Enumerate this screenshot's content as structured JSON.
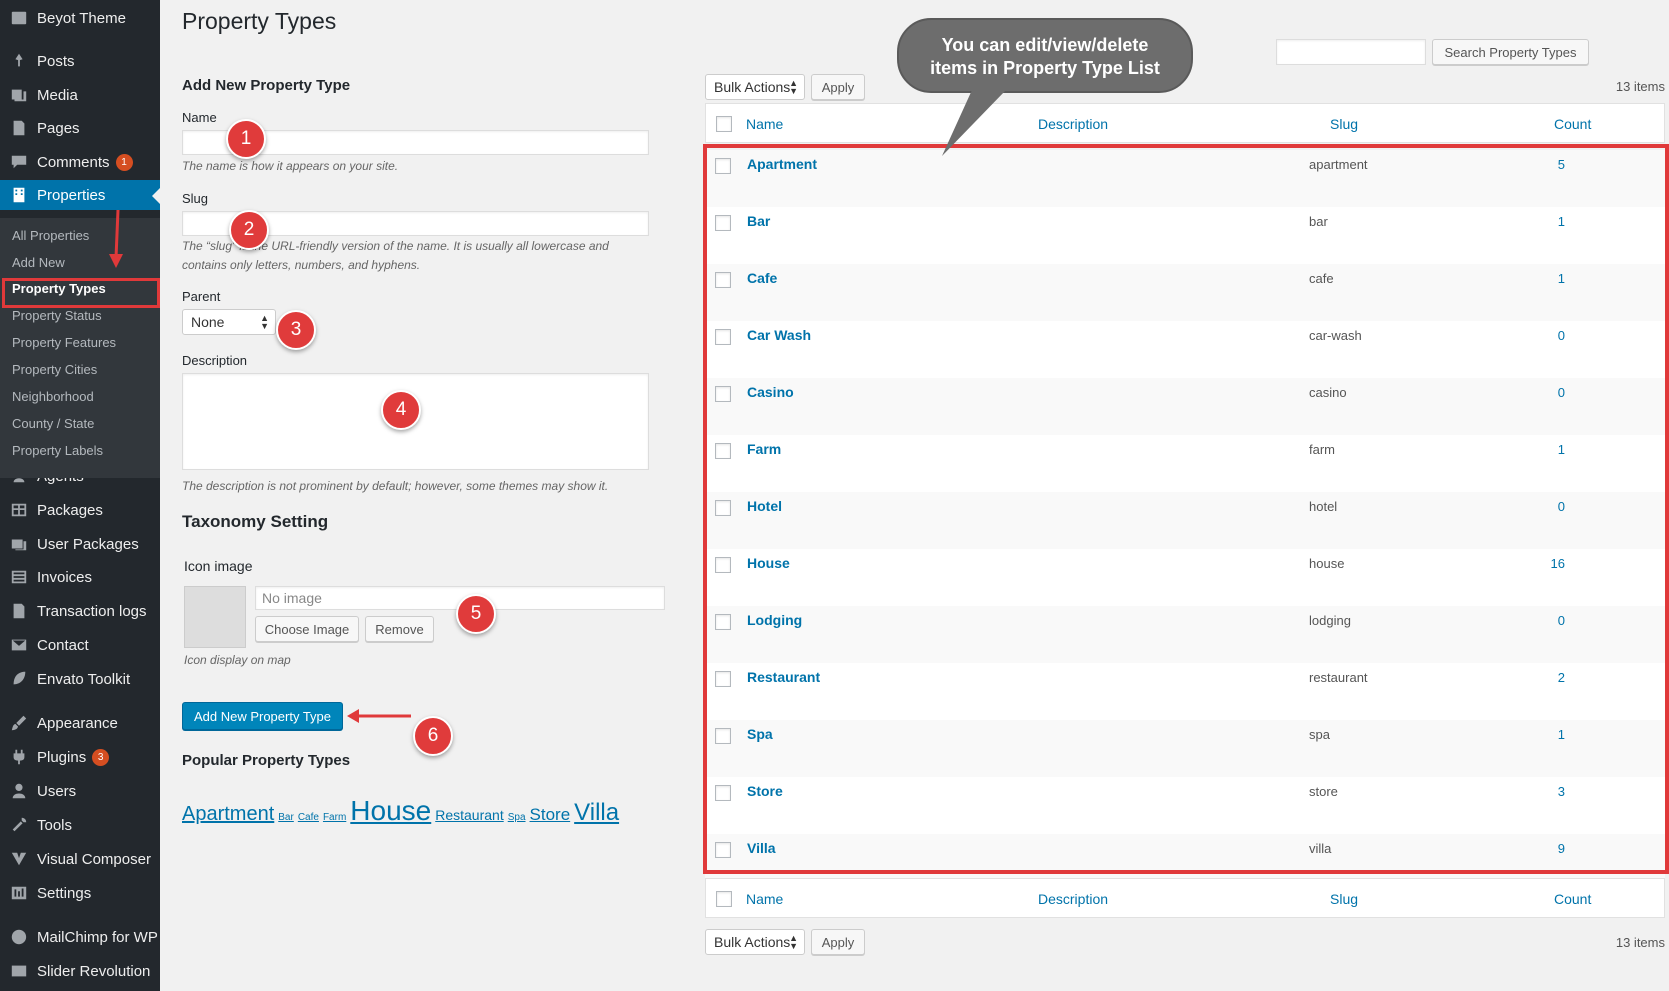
{
  "sidebar": {
    "site_title": "Beyot Theme",
    "items": [
      {
        "label": "Posts",
        "icon": "pin-icon"
      },
      {
        "label": "Media",
        "icon": "media-icon"
      },
      {
        "label": "Pages",
        "icon": "pages-icon"
      },
      {
        "label": "Comments",
        "icon": "comments-icon",
        "badge": "1"
      },
      {
        "label": "Properties",
        "icon": "building-icon",
        "active": true
      },
      {
        "label": "Agents",
        "icon": "agent-icon"
      },
      {
        "label": "Packages",
        "icon": "grid-icon"
      },
      {
        "label": "User Packages",
        "icon": "user-packages-icon"
      },
      {
        "label": "Invoices",
        "icon": "list-icon"
      },
      {
        "label": "Transaction logs",
        "icon": "log-icon"
      },
      {
        "label": "Contact",
        "icon": "mail-icon"
      },
      {
        "label": "Envato Toolkit",
        "icon": "leaf-icon"
      },
      {
        "label": "Appearance",
        "icon": "brush-icon"
      },
      {
        "label": "Plugins",
        "icon": "plugin-icon",
        "badge": "3"
      },
      {
        "label": "Users",
        "icon": "user-icon"
      },
      {
        "label": "Tools",
        "icon": "wrench-icon"
      },
      {
        "label": "Visual Composer",
        "icon": "vc-icon"
      },
      {
        "label": "Settings",
        "icon": "settings-icon"
      },
      {
        "label": "MailChimp for WP",
        "icon": "mailchimp-icon"
      },
      {
        "label": "Slider Revolution",
        "icon": "slider-icon"
      }
    ],
    "submenu": [
      "All Properties",
      "Add New",
      "Property Types",
      "Property Status",
      "Property Features",
      "Property Cities",
      "Neighborhood",
      "County / State",
      "Property Labels"
    ]
  },
  "page": {
    "title": "Property Types",
    "form_title": "Add New Property Type",
    "name_label": "Name",
    "name_hint": "The name is how it appears on your site.",
    "slug_label": "Slug",
    "slug_hint_1": "The “slug” is the URL-friendly version of the name. It is usually all lowercase and",
    "slug_hint_2": "contains only letters, numbers, and hyphens.",
    "parent_label": "Parent",
    "parent_value": "None",
    "description_label": "Description",
    "description_hint": "The description is not prominent by default; however, some themes may show it.",
    "taxonomy_title": "Taxonomy Setting",
    "icon_label": "Icon image",
    "icon_placeholder": "No image",
    "choose_image": "Choose Image",
    "remove": "Remove",
    "icon_hint": "Icon display on map",
    "submit": "Add New Property Type",
    "popular_title": "Popular Property Types",
    "tags": [
      {
        "label": "Apartment",
        "size": 20
      },
      {
        "label": "Bar",
        "size": 10
      },
      {
        "label": "Cafe",
        "size": 10
      },
      {
        "label": "Farm",
        "size": 10
      },
      {
        "label": "House",
        "size": 28
      },
      {
        "label": "Restaurant",
        "size": 14
      },
      {
        "label": "Spa",
        "size": 10
      },
      {
        "label": "Store",
        "size": 17
      },
      {
        "label": "Villa",
        "size": 24
      }
    ]
  },
  "list": {
    "search_button": "Search Property Types",
    "bulk_actions": "Bulk Actions",
    "apply": "Apply",
    "items_count": "13 items",
    "columns": {
      "name": "Name",
      "description": "Description",
      "slug": "Slug",
      "count": "Count"
    },
    "rows": [
      {
        "name": "Apartment",
        "slug": "apartment",
        "count": "5"
      },
      {
        "name": "Bar",
        "slug": "bar",
        "count": "1"
      },
      {
        "name": "Cafe",
        "slug": "cafe",
        "count": "1"
      },
      {
        "name": "Car Wash",
        "slug": "car-wash",
        "count": "0"
      },
      {
        "name": "Casino",
        "slug": "casino",
        "count": "0"
      },
      {
        "name": "Farm",
        "slug": "farm",
        "count": "1"
      },
      {
        "name": "Hotel",
        "slug": "hotel",
        "count": "0"
      },
      {
        "name": "House",
        "slug": "house",
        "count": "16"
      },
      {
        "name": "Lodging",
        "slug": "lodging",
        "count": "0"
      },
      {
        "name": "Restaurant",
        "slug": "restaurant",
        "count": "2"
      },
      {
        "name": "Spa",
        "slug": "spa",
        "count": "1"
      },
      {
        "name": "Store",
        "slug": "store",
        "count": "3"
      },
      {
        "name": "Villa",
        "slug": "villa",
        "count": "9"
      }
    ]
  },
  "annotations": {
    "callout_1": "You can edit/view/delete",
    "callout_2": "items in Property Type List",
    "markers": [
      "1",
      "2",
      "3",
      "4",
      "5",
      "6"
    ],
    "color": "#e03b3b"
  },
  "colors": {
    "sidebar": "#23282d",
    "accent": "#0073aa",
    "highlight": "#e0393a"
  }
}
